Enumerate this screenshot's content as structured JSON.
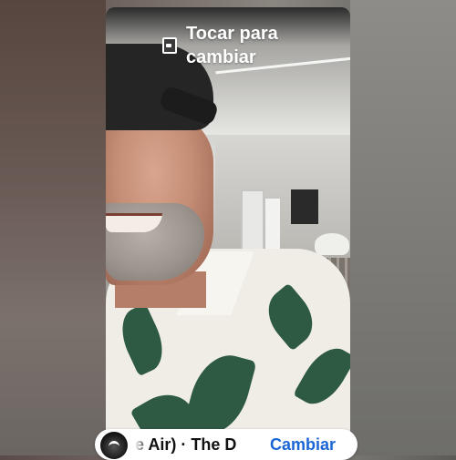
{
  "tap_to_change": {
    "label": "Tocar para cambiar",
    "icon": "photo-icon"
  },
  "music_sticker": {
    "track_text": "e Air) · The D",
    "change_label": "Cambiar",
    "change_color": "#1a66d6",
    "icon": "album-art-icon"
  }
}
